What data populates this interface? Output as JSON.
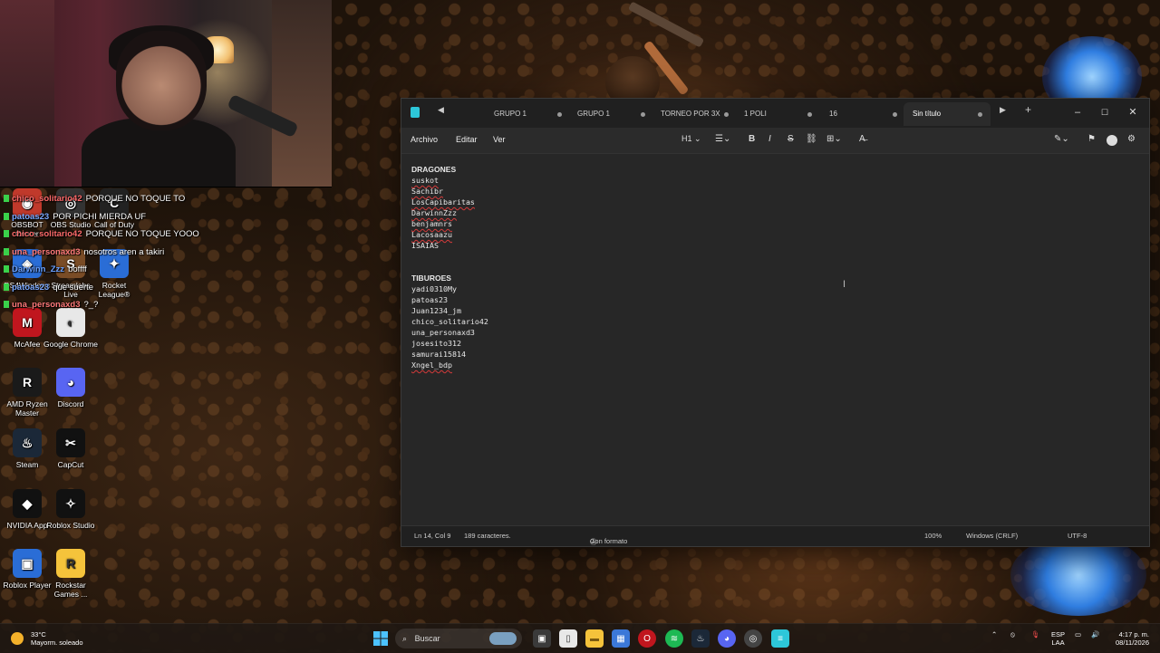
{
  "webcam": {
    "label": "streamer webcam"
  },
  "chat": [
    {
      "user": "chico_solitario42",
      "message": "PORQUE NO TOQUE TO",
      "color": "#ff6b6b"
    },
    {
      "user": "patoas23",
      "message": "POR PICHI MIERDA UF",
      "color": "#7aa8ff"
    },
    {
      "user": "chico_solitario42",
      "message": "PORQUE NO TOQUE YOOO",
      "color": "#ff6b6b"
    },
    {
      "user": "una_personaxd3",
      "message": "nosotros aren a takiri",
      "color": "#ff7a7a"
    },
    {
      "user": "Darwinn_Zzz",
      "message": "boffff",
      "color": "#6aa0ff"
    },
    {
      "user": "patoas23",
      "message": "que suerte",
      "color": "#7aa8ff"
    },
    {
      "user": "una_personaxd3",
      "message": "?_?",
      "color": "#ff7a7a"
    }
  ],
  "desktop_icons": [
    {
      "label": "OBSBOT Center",
      "icon": "obsbot-icon"
    },
    {
      "label": "OBS Studio",
      "icon": "obs-icon"
    },
    {
      "label": "Call of Duty",
      "icon": "cod-icon"
    },
    {
      "label": "DS4Windows",
      "icon": "ds4-icon"
    },
    {
      "label": "Streamlabs Live",
      "icon": "streamlabs-icon"
    },
    {
      "label": "Rocket League®",
      "icon": "rocket-league-icon"
    },
    {
      "label": "McAfee",
      "icon": "mcafee-icon"
    },
    {
      "label": "Google Chrome",
      "icon": "chrome-icon"
    },
    {
      "label": "AMD Ryzen Master",
      "icon": "amd-icon"
    },
    {
      "label": "Discord",
      "icon": "discord-icon"
    },
    {
      "label": "Steam",
      "icon": "steam-icon"
    },
    {
      "label": "CapCut",
      "icon": "capcut-icon"
    },
    {
      "label": "NVIDIA App",
      "icon": "nvidia-icon"
    },
    {
      "label": "Roblox Studio",
      "icon": "roblox-studio-icon"
    },
    {
      "label": "Roblox Player",
      "icon": "roblox-player-icon"
    },
    {
      "label": "Rockstar Games ...",
      "icon": "rockstar-icon"
    }
  ],
  "notepad": {
    "tabs": [
      "GRUPO 1",
      "GRUPO 1",
      "TORNEO POR 3X",
      "1 POLI",
      "16",
      "Sin título"
    ],
    "menu": {
      "file": "Archivo",
      "edit": "Editar",
      "view": "Ver"
    },
    "toolbar": {
      "heading": "H1"
    },
    "lines": [
      {
        "text": "DRAGONES",
        "heading": true
      },
      {
        "text": "suskot",
        "spell": true
      },
      {
        "text": "Sachibr",
        "spell": true
      },
      {
        "text": "LosCapibaritas",
        "spell": true
      },
      {
        "text": "DarwinnZzz",
        "spell": true
      },
      {
        "text": "benjamnrs",
        "spell": true
      },
      {
        "text": "Lacosaazu",
        "spell": true
      },
      {
        "text": "ISAIAS",
        "spell": false
      },
      {
        "text": "",
        "spell": false
      },
      {
        "text": "",
        "spell": false
      },
      {
        "text": "TIBUROES",
        "heading": true
      },
      {
        "text": "yadi0310My",
        "spell": false
      },
      {
        "text": "patoas23",
        "spell": false
      },
      {
        "text": "Juan1234_jm",
        "spell": false
      },
      {
        "text": "chico_solitario42",
        "spell": false
      },
      {
        "text": "una_personaxd3",
        "spell": false
      },
      {
        "text": "josesito312",
        "spell": false
      },
      {
        "text": "samurai15814",
        "spell": false
      },
      {
        "text": "Xngel_bdp",
        "spell": true
      }
    ],
    "status": {
      "position": "Ln 14, Col 9",
      "chars": "189 caracteres.",
      "format": "Con formato",
      "zoom": "100%",
      "line_ending": "Windows (CRLF)",
      "encoding": "UTF-8"
    }
  },
  "taskbar": {
    "weather_temp": "33°C",
    "weather_desc": "Mayorm. soleado",
    "search_placeholder": "Buscar",
    "lang": "ESP",
    "lang_sub": "LAA",
    "time": "4:17 p. m.",
    "date": "08/11/2026"
  }
}
